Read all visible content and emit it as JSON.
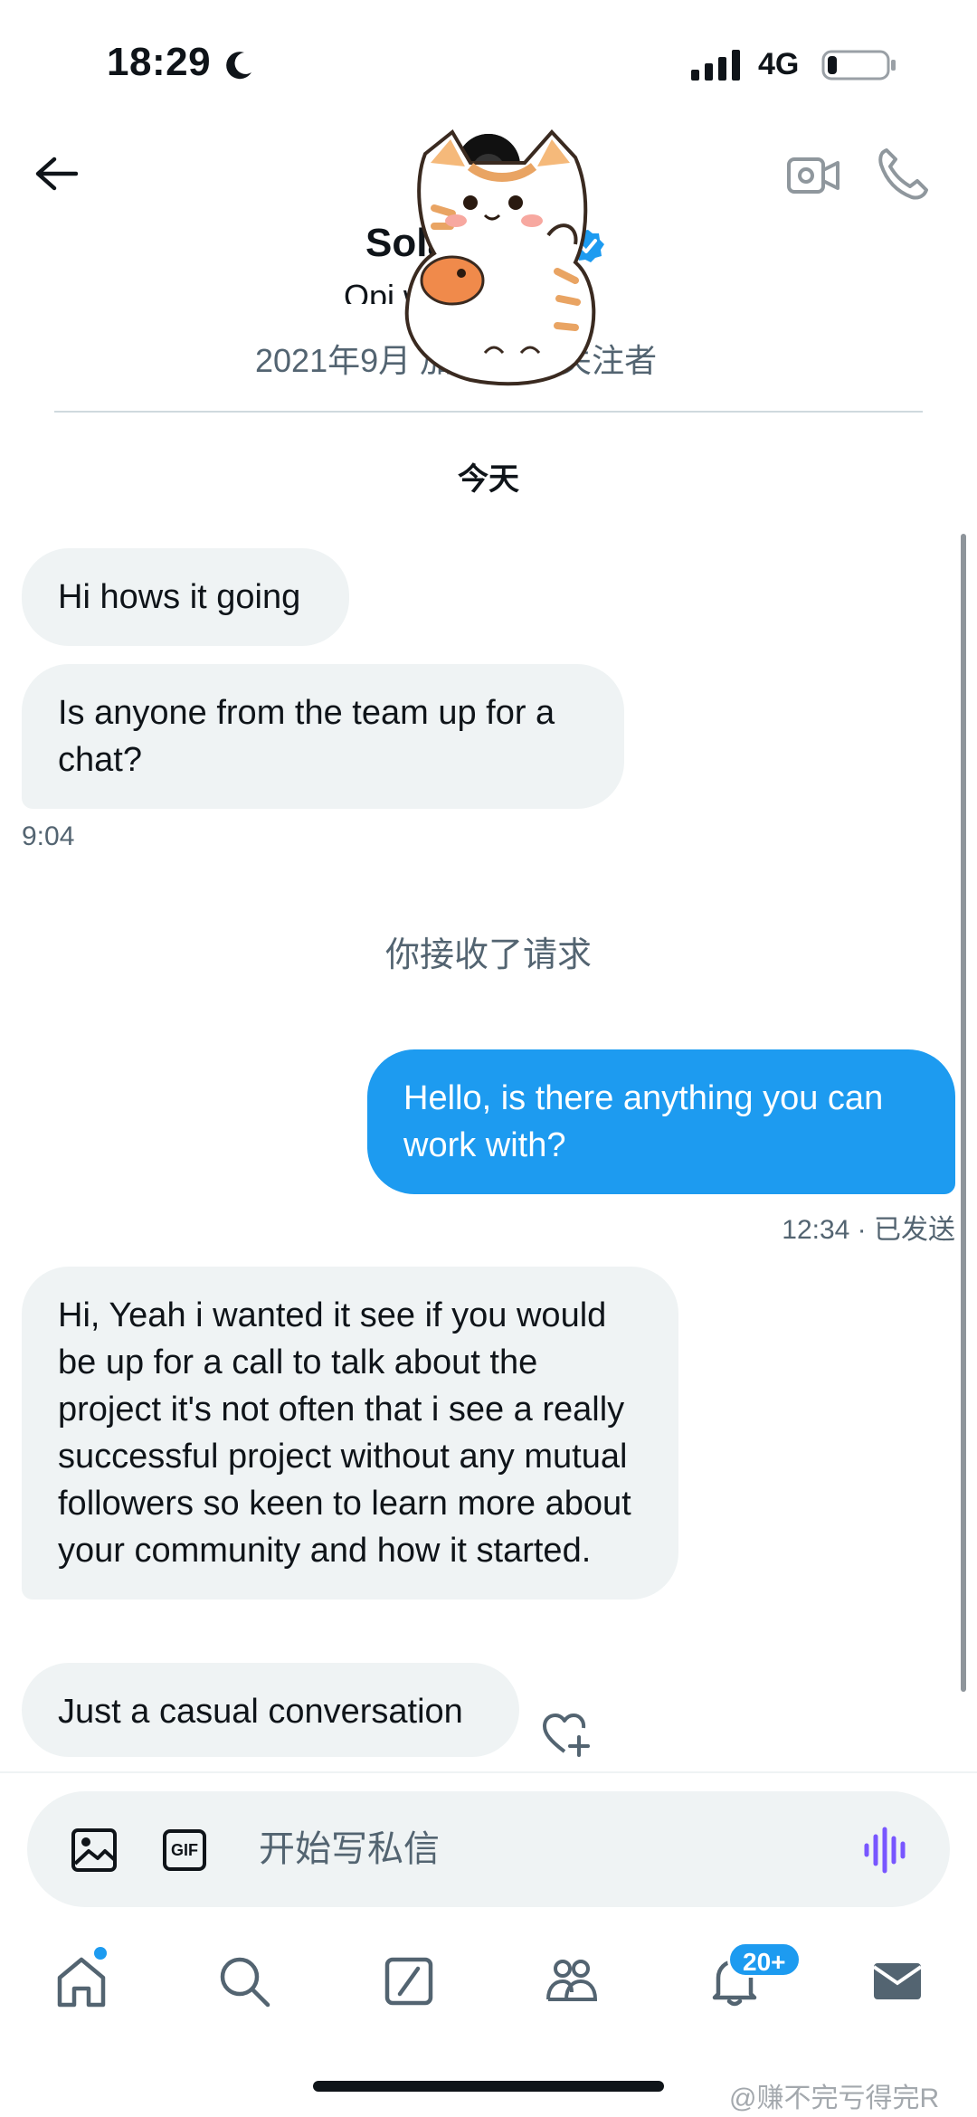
{
  "status_bar": {
    "time": "18:29",
    "network": "4G",
    "icons": [
      "moon-icon",
      "signal-icon",
      "battery-icon"
    ]
  },
  "header": {
    "name": "Sola",
    "bio": "Opi wn",
    "meta": "2021年9月 加入 · 27 关注者",
    "icons": [
      "back-arrow-icon",
      "video-camera-icon",
      "phone-icon",
      "verified-badge-icon"
    ]
  },
  "conversation": {
    "day_label": "今天",
    "messages": [
      {
        "direction": "in",
        "text": "Hi hows it going"
      },
      {
        "direction": "in",
        "text": "Is anyone from the team up for a chat?",
        "time": "9:04"
      },
      {
        "direction": "system",
        "text": "你接收了请求"
      },
      {
        "direction": "out",
        "text": "Hello, is there anything you can work with?",
        "time": "12:34 · 已发送"
      },
      {
        "direction": "in",
        "text": "Hi, Yeah i wanted it see if you would be up for a call to talk about the project it's not often that i see a really successful project without any mutual followers so keen to learn more about your community and how it started."
      },
      {
        "direction": "in",
        "text": "Just a casual conversation"
      }
    ]
  },
  "composer": {
    "placeholder": "开始写私信",
    "gif_label": "GIF",
    "icons": [
      "image-icon",
      "gif-icon",
      "voice-wave-icon"
    ]
  },
  "bottom_nav": {
    "items": [
      "home-icon",
      "search-icon",
      "grok-icon",
      "communities-icon",
      "notifications-icon",
      "messages-icon"
    ],
    "notification_badge": "20+"
  },
  "watermark": "@赚不完亏得完R",
  "colors": {
    "accent": "#1d9bf0",
    "incoming_bubble": "#eff3f4",
    "secondary_text": "#536471",
    "voice_icon": "#7856ff"
  }
}
